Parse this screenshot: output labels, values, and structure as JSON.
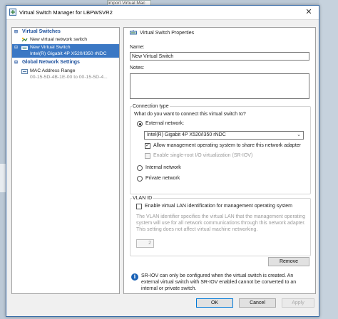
{
  "background": {
    "behind_window_title": "Import Virtual Mac"
  },
  "window": {
    "title": "Virtual Switch Manager for LBPWSVR2",
    "close_glyph": "✕"
  },
  "tree": {
    "virtual_switches_header": "Virtual Switches",
    "new_switch_item": "New virtual network switch",
    "selected_item": {
      "name": "New Virtual Switch",
      "adapter": "Intel(R) Gigabit 4P X520/I350 rNDC"
    },
    "global_header": "Global Network Settings",
    "mac_range": {
      "name": "MAC Address Range",
      "value": "00-15-5D-4B-1E-00 to 00-15-5D-4..."
    }
  },
  "properties": {
    "title": "Virtual Switch Properties",
    "name_label": "Name:",
    "name_value": "New Virtual Switch",
    "notes_label": "Notes:",
    "notes_value": "",
    "connection": {
      "group_label": "Connection type",
      "question": "What do you want to connect this virtual switch to?",
      "external_label": "External network:",
      "adapter_selected": "Intel(R) Gigabit 4P X520/I350 rNDC",
      "allow_mgmt_label": "Allow management operating system to share this network adapter",
      "allow_mgmt_checked": true,
      "sriov_label": "Enable single-root I/O virtualization (SR-IOV)",
      "sriov_checked": false,
      "internal_label": "Internal network",
      "private_label": "Private network",
      "selected": "external"
    },
    "vlan": {
      "group_label": "VLAN ID",
      "enable_label": "Enable virtual LAN identification for management operating system",
      "enable_checked": false,
      "description": "The VLAN identifier specifies the virtual LAN that the management operating system will use for all network communications through this network adapter. This setting does not affect virtual machine networking.",
      "value": "2"
    },
    "remove_button": "Remove",
    "info_text": "SR-IOV can only be configured when the virtual switch is created. An external virtual switch with SR-IOV enabled cannot be converted to an internal or private switch."
  },
  "footer": {
    "ok": "OK",
    "cancel": "Cancel",
    "apply": "Apply"
  },
  "colors": {
    "accent": "#0078d7",
    "selection": "#3b78c4",
    "tree_header": "#1b4f9c",
    "info_icon": "#1a62b6"
  }
}
